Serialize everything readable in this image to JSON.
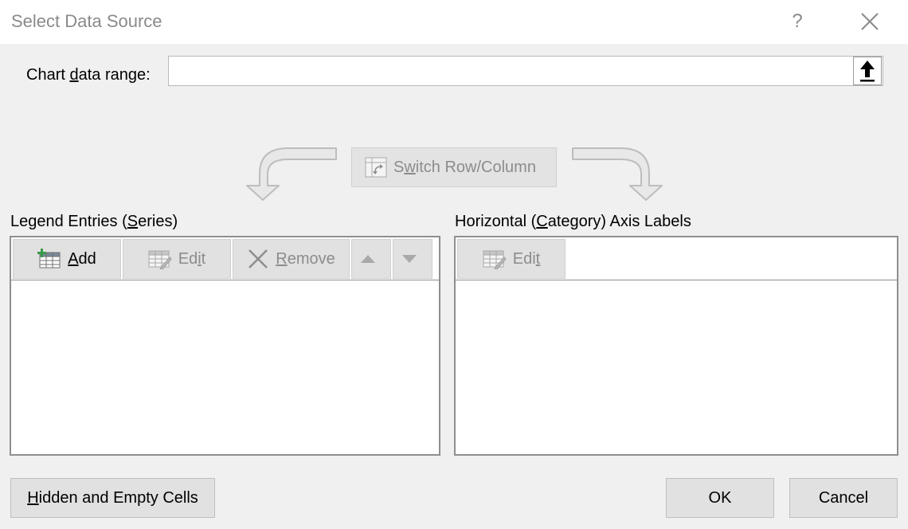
{
  "window": {
    "title": "Select Data Source",
    "help_glyph": "?"
  },
  "range": {
    "label_pre": "Chart ",
    "label_key": "d",
    "label_post": "ata range:",
    "value": ""
  },
  "switch": {
    "pre": "S",
    "key": "w",
    "post": "itch Row/Column"
  },
  "series": {
    "label_pre": "Legend Entries (",
    "label_key": "S",
    "label_post": "eries)",
    "add": {
      "key": "A",
      "rest": "dd"
    },
    "edit": {
      "pre": "Ed",
      "key": "i",
      "post": "t"
    },
    "remove": {
      "key": "R",
      "rest": "emove"
    }
  },
  "category": {
    "label_pre": "Horizontal (",
    "label_key": "C",
    "label_post": "ategory) Axis Labels",
    "edit": {
      "pre": "Edi",
      "key": "t",
      "post": ""
    }
  },
  "footer": {
    "hidden": {
      "key": "H",
      "rest": "idden and Empty Cells"
    },
    "ok_label": "OK",
    "cancel_label": "Cancel"
  },
  "colors": {
    "disabled_text": "#8c8c8c",
    "add_icon_plus": "#3a9a4a"
  }
}
